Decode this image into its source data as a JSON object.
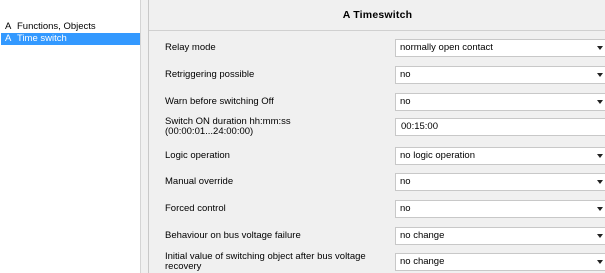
{
  "tree": {
    "items": [
      {
        "letter": "A",
        "label": "Functions, Objects",
        "selected": false
      },
      {
        "letter": "A",
        "label": "Time switch",
        "selected": true
      }
    ]
  },
  "main": {
    "title": "A Timeswitch",
    "params": [
      {
        "label": "Relay mode",
        "value": "normally open contact",
        "control": "dropdown"
      },
      {
        "label": "Retriggering possible",
        "value": "no",
        "control": "dropdown"
      },
      {
        "label": "Warn before switching Off",
        "value": "no",
        "control": "dropdown"
      },
      {
        "label_line1": "Switch ON duration hh:mm:ss",
        "label_line2": "(00:00:01...24:00:00)",
        "value": "00:15:00",
        "control": "text"
      },
      {
        "label": "Logic operation",
        "value": "no logic operation",
        "control": "dropdown"
      },
      {
        "label": "Manual override",
        "value": "no",
        "control": "dropdown"
      },
      {
        "label": "Forced control",
        "value": "no",
        "control": "dropdown"
      },
      {
        "label": "Behaviour on bus voltage failure",
        "value": "no change",
        "control": "dropdown"
      },
      {
        "label_line1": "Initial value of switching object after bus voltage",
        "label_line2": "recovery",
        "value": "no change",
        "control": "dropdown"
      }
    ]
  }
}
